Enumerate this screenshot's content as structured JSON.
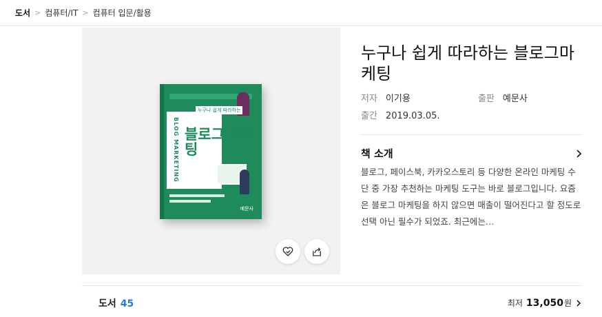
{
  "breadcrumb": [
    "도서",
    "컴퓨터/IT",
    "컴퓨터 입문/활용"
  ],
  "book": {
    "title": "누구나 쉽게 따라하는 블로그마케팅",
    "cover_title": "블로그 마케팅",
    "cover_subtitle": "누구나 쉽게 따라하는",
    "cover_spine_text": "BLOG MARKETING",
    "cover_publisher": "예문사",
    "author_label": "저자",
    "author": "이기용",
    "publisher_label": "출판",
    "publisher": "예문사",
    "date_label": "출간",
    "date": "2019.03.05."
  },
  "intro": {
    "heading": "책 소개",
    "text": "블로그, 페이스북, 카카오스토리 등 다양한 온라인 마케팅 수단 중 가장 추천하는 마케팅 도구는 바로 블로그입니다. 요즘은 블로그 마케팅을 하지 않으면 매출이 떨어진다고 할 정도로 선택 아닌 필수가 되었죠. 최근에는…"
  },
  "footer": {
    "category": "도서",
    "count": "45",
    "lowest_label": "최저",
    "lowest_price": "13,050",
    "currency": "원"
  },
  "colors": {
    "cover_green": "#1f8a5b",
    "count_blue": "#2c7ad6"
  },
  "icons": [
    "chevron-right-icon",
    "heart-check-icon",
    "share-icon"
  ]
}
